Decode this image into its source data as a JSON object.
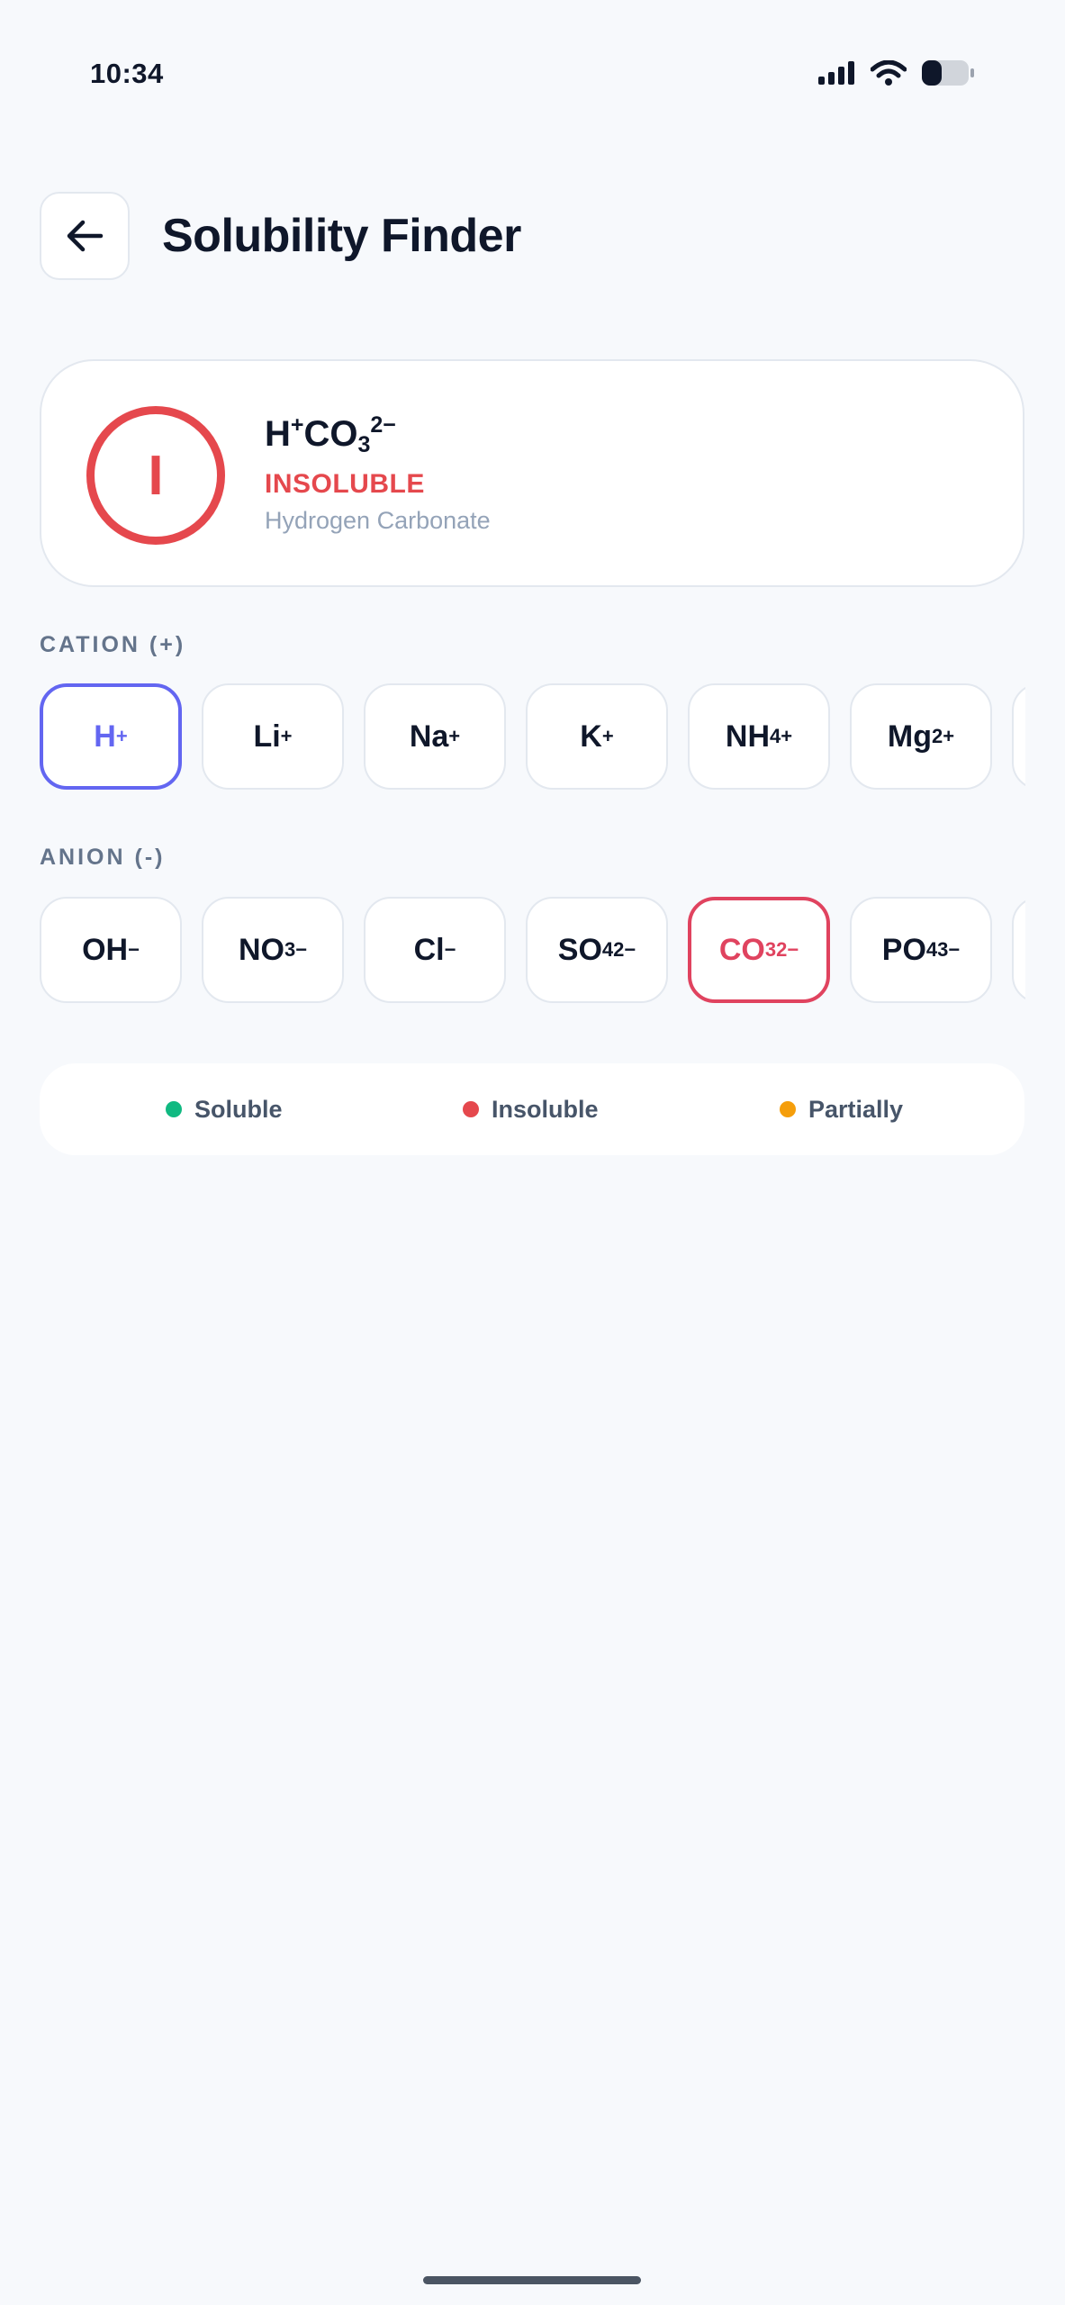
{
  "status_bar": {
    "time": "10:34",
    "icons": [
      "signal-icon",
      "wifi-icon",
      "battery-icon"
    ]
  },
  "header": {
    "back_icon": "arrow-left-icon",
    "title": "Solubility Finder"
  },
  "result": {
    "badge_letter": "I",
    "formula_cation": {
      "base": "H",
      "charge": "+"
    },
    "formula_anion": {
      "base": "CO",
      "sub": "3",
      "charge": "2−"
    },
    "status": "INSOLUBLE",
    "name": "Hydrogen Carbonate",
    "status_color": "#e5484d"
  },
  "cation": {
    "label": "CATION (+)",
    "selected_index": 0,
    "items": [
      {
        "base": "H",
        "sub": "",
        "charge": "+"
      },
      {
        "base": "Li",
        "sub": "",
        "charge": "+"
      },
      {
        "base": "Na",
        "sub": "",
        "charge": "+"
      },
      {
        "base": "K",
        "sub": "",
        "charge": "+"
      },
      {
        "base": "NH",
        "sub": "4",
        "charge": "+"
      },
      {
        "base": "Mg",
        "sub": "",
        "charge": "2+"
      },
      {
        "base": "",
        "sub": "",
        "charge": ""
      }
    ]
  },
  "anion": {
    "label": "ANION (-)",
    "selected_index": 4,
    "items": [
      {
        "base": "OH",
        "sub": "",
        "charge": "−"
      },
      {
        "base": "NO",
        "sub": "3",
        "charge": "−"
      },
      {
        "base": "Cl",
        "sub": "",
        "charge": "−"
      },
      {
        "base": "SO",
        "sub": "4",
        "charge": "2−"
      },
      {
        "base": "CO",
        "sub": "3",
        "charge": "2−"
      },
      {
        "base": "PO",
        "sub": "4",
        "charge": "3−"
      },
      {
        "base": "",
        "sub": "",
        "charge": ""
      }
    ]
  },
  "legend": {
    "items": [
      {
        "label": "Soluble",
        "color": "#10b981"
      },
      {
        "label": "Insoluble",
        "color": "#e5484d"
      },
      {
        "label": "Partially",
        "color": "#f59e0b"
      }
    ]
  },
  "colors": {
    "accent_cation": "#6366f1",
    "accent_anion": "#e0435f"
  }
}
